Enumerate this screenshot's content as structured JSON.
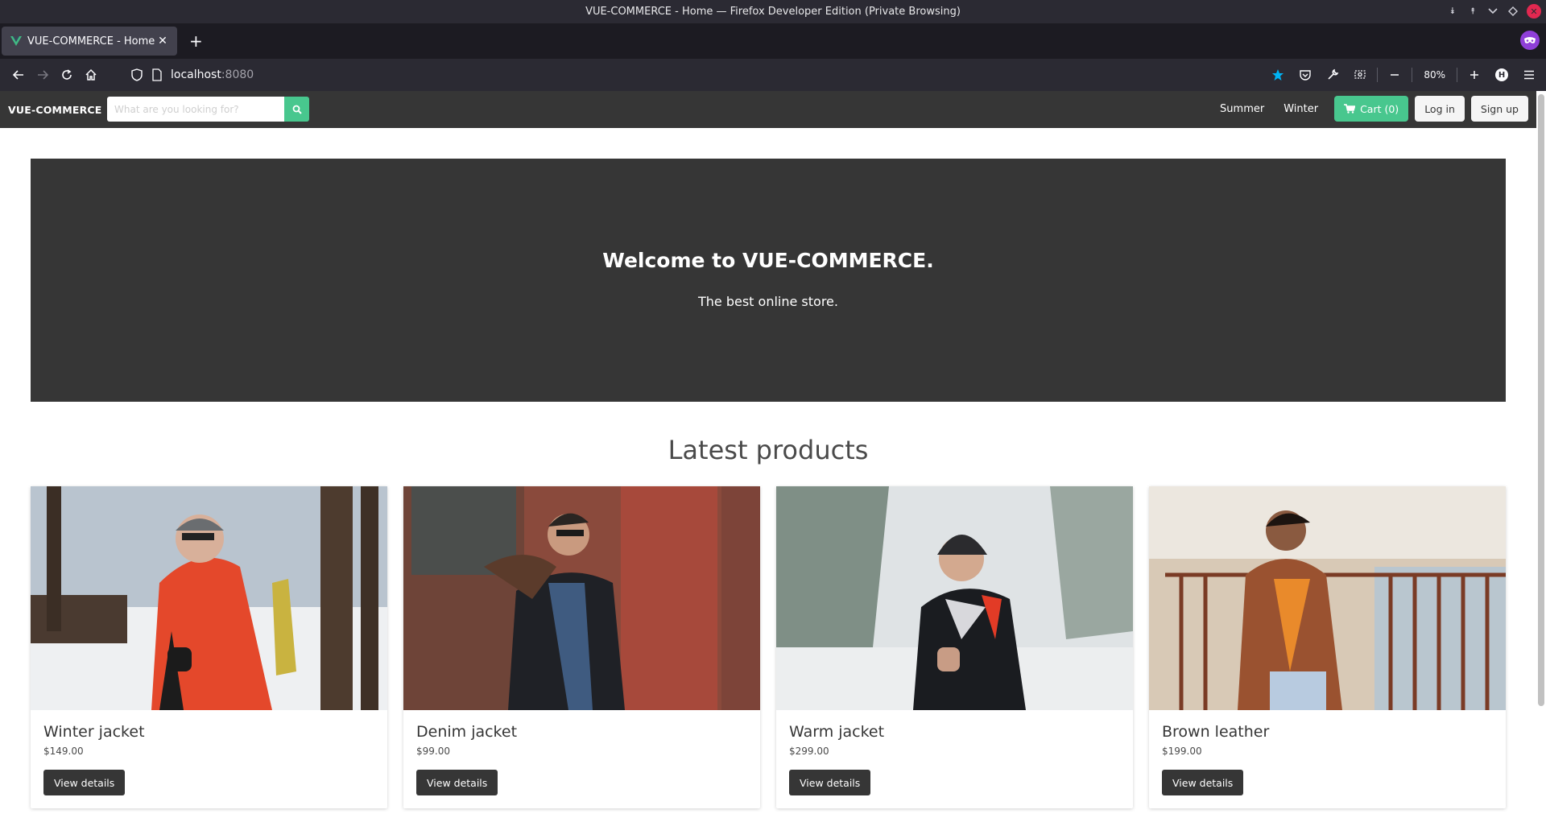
{
  "window": {
    "title": "VUE-COMMERCE - Home — Firefox Developer Edition (Private Browsing)"
  },
  "browser": {
    "tab_title": "VUE-COMMERCE - Home",
    "url_host": "localhost",
    "url_port": ":8080",
    "zoom": "80%",
    "account_initial": "H"
  },
  "site": {
    "brand": "VUE-COMMERCE",
    "search_placeholder": "What are you looking for?",
    "nav_links": [
      "Summer",
      "Winter"
    ],
    "cart_label": "Cart (0)",
    "login_label": "Log in",
    "signup_label": "Sign up",
    "accent_color": "#48c78e",
    "dark_color": "#363636"
  },
  "hero": {
    "title": "Welcome to VUE-COMMERCE.",
    "subtitle": "The best online store."
  },
  "latest": {
    "heading": "Latest products",
    "products": [
      {
        "name": "Winter jacket",
        "price": "$149.00",
        "button": "View details"
      },
      {
        "name": "Denim jacket",
        "price": "$99.00",
        "button": "View details"
      },
      {
        "name": "Warm jacket",
        "price": "$299.00",
        "button": "View details"
      },
      {
        "name": "Brown leather",
        "price": "$199.00",
        "button": "View details"
      }
    ]
  }
}
